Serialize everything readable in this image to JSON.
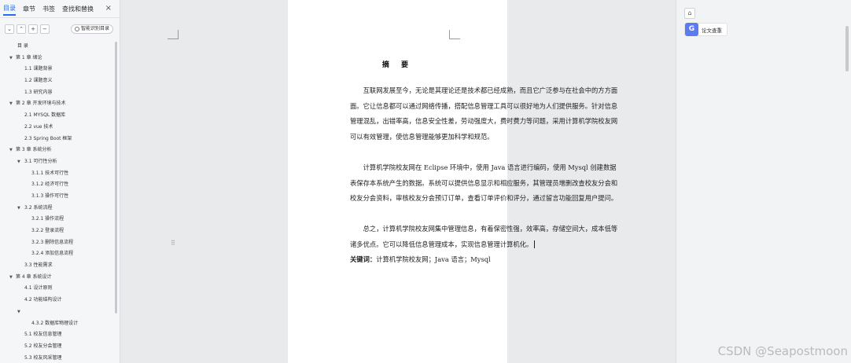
{
  "left_panel": {
    "tabs": [
      {
        "label": "目录"
      },
      {
        "label": "章节"
      },
      {
        "label": "书签"
      },
      {
        "label": "查找和替换"
      }
    ],
    "close_icon": "×",
    "toolbar": {
      "collapse_icon": "⌄",
      "expand_icon": "⌃",
      "add_icon": "+",
      "remove_icon": "−",
      "smart_label": "智能识别目录"
    },
    "toc": [
      {
        "label": "目  录",
        "level": 0,
        "arrow": false
      },
      {
        "label": "第 1 章  绪论",
        "level": 1,
        "arrow": true
      },
      {
        "label": "1.1  课题背景",
        "level": 2,
        "arrow": false
      },
      {
        "label": "1.2  课题意义",
        "level": 2,
        "arrow": false
      },
      {
        "label": "1.3  研究内容",
        "level": 2,
        "arrow": false
      },
      {
        "label": "第 2 章  开发环境与技术",
        "level": 1,
        "arrow": true
      },
      {
        "label": "2.1 MYSQL 数据库",
        "level": 2,
        "arrow": false
      },
      {
        "label": "2.2 vue 技术",
        "level": 2,
        "arrow": false
      },
      {
        "label": "2.3 Spring Boot 框架",
        "level": 2,
        "arrow": false
      },
      {
        "label": "第 3 章  系统分析",
        "level": 1,
        "arrow": true
      },
      {
        "label": "3.1  可行性分析",
        "level": 2,
        "arrow": true
      },
      {
        "label": "3.1.1  技术可行性",
        "level": 3,
        "arrow": false
      },
      {
        "label": "3.1.2  经济可行性",
        "level": 3,
        "arrow": false
      },
      {
        "label": "3.1.3  操作可行性",
        "level": 3,
        "arrow": false
      },
      {
        "label": "3.2  系统流程",
        "level": 2,
        "arrow": true
      },
      {
        "label": "3.2.1  操作流程",
        "level": 3,
        "arrow": false
      },
      {
        "label": "3.2.2  登录流程",
        "level": 3,
        "arrow": false
      },
      {
        "label": "3.2.3  删除信息流程",
        "level": 3,
        "arrow": false
      },
      {
        "label": "3.2.4  添加信息流程",
        "level": 3,
        "arrow": false
      },
      {
        "label": "3.3  性能需求",
        "level": 2,
        "arrow": false
      },
      {
        "label": "第 4 章  系统设计",
        "level": 1,
        "arrow": true
      },
      {
        "label": "4.1  设计原则",
        "level": 2,
        "arrow": false
      },
      {
        "label": "4.2  功能结构设计",
        "level": 2,
        "arrow": false
      },
      {
        "label": "",
        "level": 2,
        "arrow": true
      },
      {
        "label": "4.3.2  数据库物理设计",
        "level": 3,
        "arrow": false
      },
      {
        "label": "5.1  校友信息管理",
        "level": 2,
        "arrow": false
      },
      {
        "label": "5.2  校友分会管理",
        "level": 2,
        "arrow": false
      },
      {
        "label": "5.3  校友风采管理",
        "level": 2,
        "arrow": false
      }
    ]
  },
  "document": {
    "title": "摘 要",
    "paragraphs": [
      "互联网发展至今，无论是其理论还是技术都已经成熟，而且它广泛参与在社会中的方方面面。它让信息都可以通过网络传播，搭配信息管理工具可以很好地为人们提供服务。针对信息管理混乱，出错率高，信息安全性差，劳动强度大，费时费力等问题，采用计算机学院校友网可以有效管理，使信息管理能够更加科学和规范。",
      "计算机学院校友网在 Eclipse 环境中，使用 Java 语言进行编码，使用 Mysql 创建数据表保存本系统产生的数据。系统可以提供信息显示和相应服务，其管理员增删改查校友分会和校友分会资料，审核校友分会预订订单，查看订单评价和评分，通过留言功能回复用户提问。",
      "总之，计算机学院校友网集中管理信息，有着保密性强，效率高，存储空间大，成本低等诸多优点。它可以降低信息管理成本，实现信息管理计算机化。"
    ],
    "keywords_label": "关键词：",
    "keywords": "计算机学院校友网；Java 语言；Mysql",
    "drag_handle_icon": "⠿"
  },
  "right_panel": {
    "top_icon": "⌂",
    "button_icon": "G",
    "button_label": "论文查重"
  },
  "watermark": "CSDN @Seapostmoon"
}
